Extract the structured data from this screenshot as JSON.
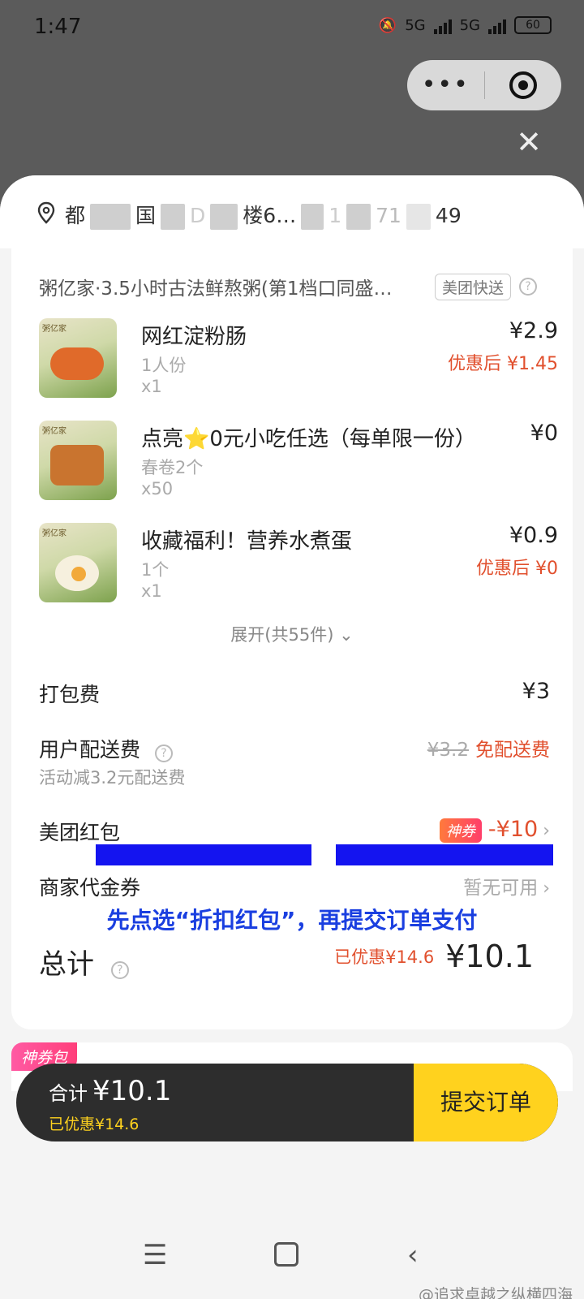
{
  "status_bar": {
    "time": "1:47",
    "net1": "5G",
    "net2": "5G",
    "battery": "60"
  },
  "capsule": {
    "more_icon": "more-icon",
    "target_icon": "target-icon"
  },
  "close_icon": "close-icon",
  "address": {
    "icon": "location-pin-icon",
    "seg1": "都",
    "seg2": "国",
    "seg3": "D",
    "seg4": "楼6…",
    "seg5": "1",
    "seg6": "71",
    "seg7": "49"
  },
  "store": {
    "name": "粥亿家·3.5小时古法鲜熬粥(第1档口同盛…",
    "tag": "美团快送",
    "help": "?"
  },
  "items": [
    {
      "name": "网红淀粉肠",
      "spec": "1人份",
      "qty": "x1",
      "price": "¥2.9",
      "discount": "优惠后 ¥1.45"
    },
    {
      "name": "点亮⭐0元小吃任选（每单限一份）",
      "spec": "春卷2个",
      "qty": "x50",
      "price": "¥0",
      "discount": ""
    },
    {
      "name": "收藏福利！营养水煮蛋",
      "spec": "1个",
      "qty": "x1",
      "price": "¥0.9",
      "discount": "优惠后 ¥0"
    }
  ],
  "expand": {
    "label": "展开(共55件)",
    "icon": "chevron-down-icon"
  },
  "fees": {
    "packing": {
      "label": "打包费",
      "value": "¥3"
    },
    "delivery": {
      "label": "用户配送费",
      "original": "¥3.2",
      "value": "免配送费",
      "sub": "活动减3.2元配送费"
    },
    "redpacket": {
      "label": "美团红包",
      "badge": "神券",
      "value": "-¥10"
    },
    "voucher": {
      "label": "商家代金券",
      "value": "暂无可用"
    }
  },
  "notice": "先点选“折扣红包”，再提交订单支付",
  "total": {
    "label": "总计",
    "discount": "已优惠¥14.6",
    "amount": "¥10.1"
  },
  "coupon_pack": {
    "tag": "神券包"
  },
  "checkout": {
    "total_label": "合计",
    "total_amount": "¥10.1",
    "discount": "已优惠¥14.6",
    "submit": "提交订单"
  },
  "nav": {
    "menu_icon": "menu-icon",
    "home_icon": "home-square-icon",
    "back_icon": "back-icon"
  },
  "watermark": "@追求卓越之纵横四海"
}
